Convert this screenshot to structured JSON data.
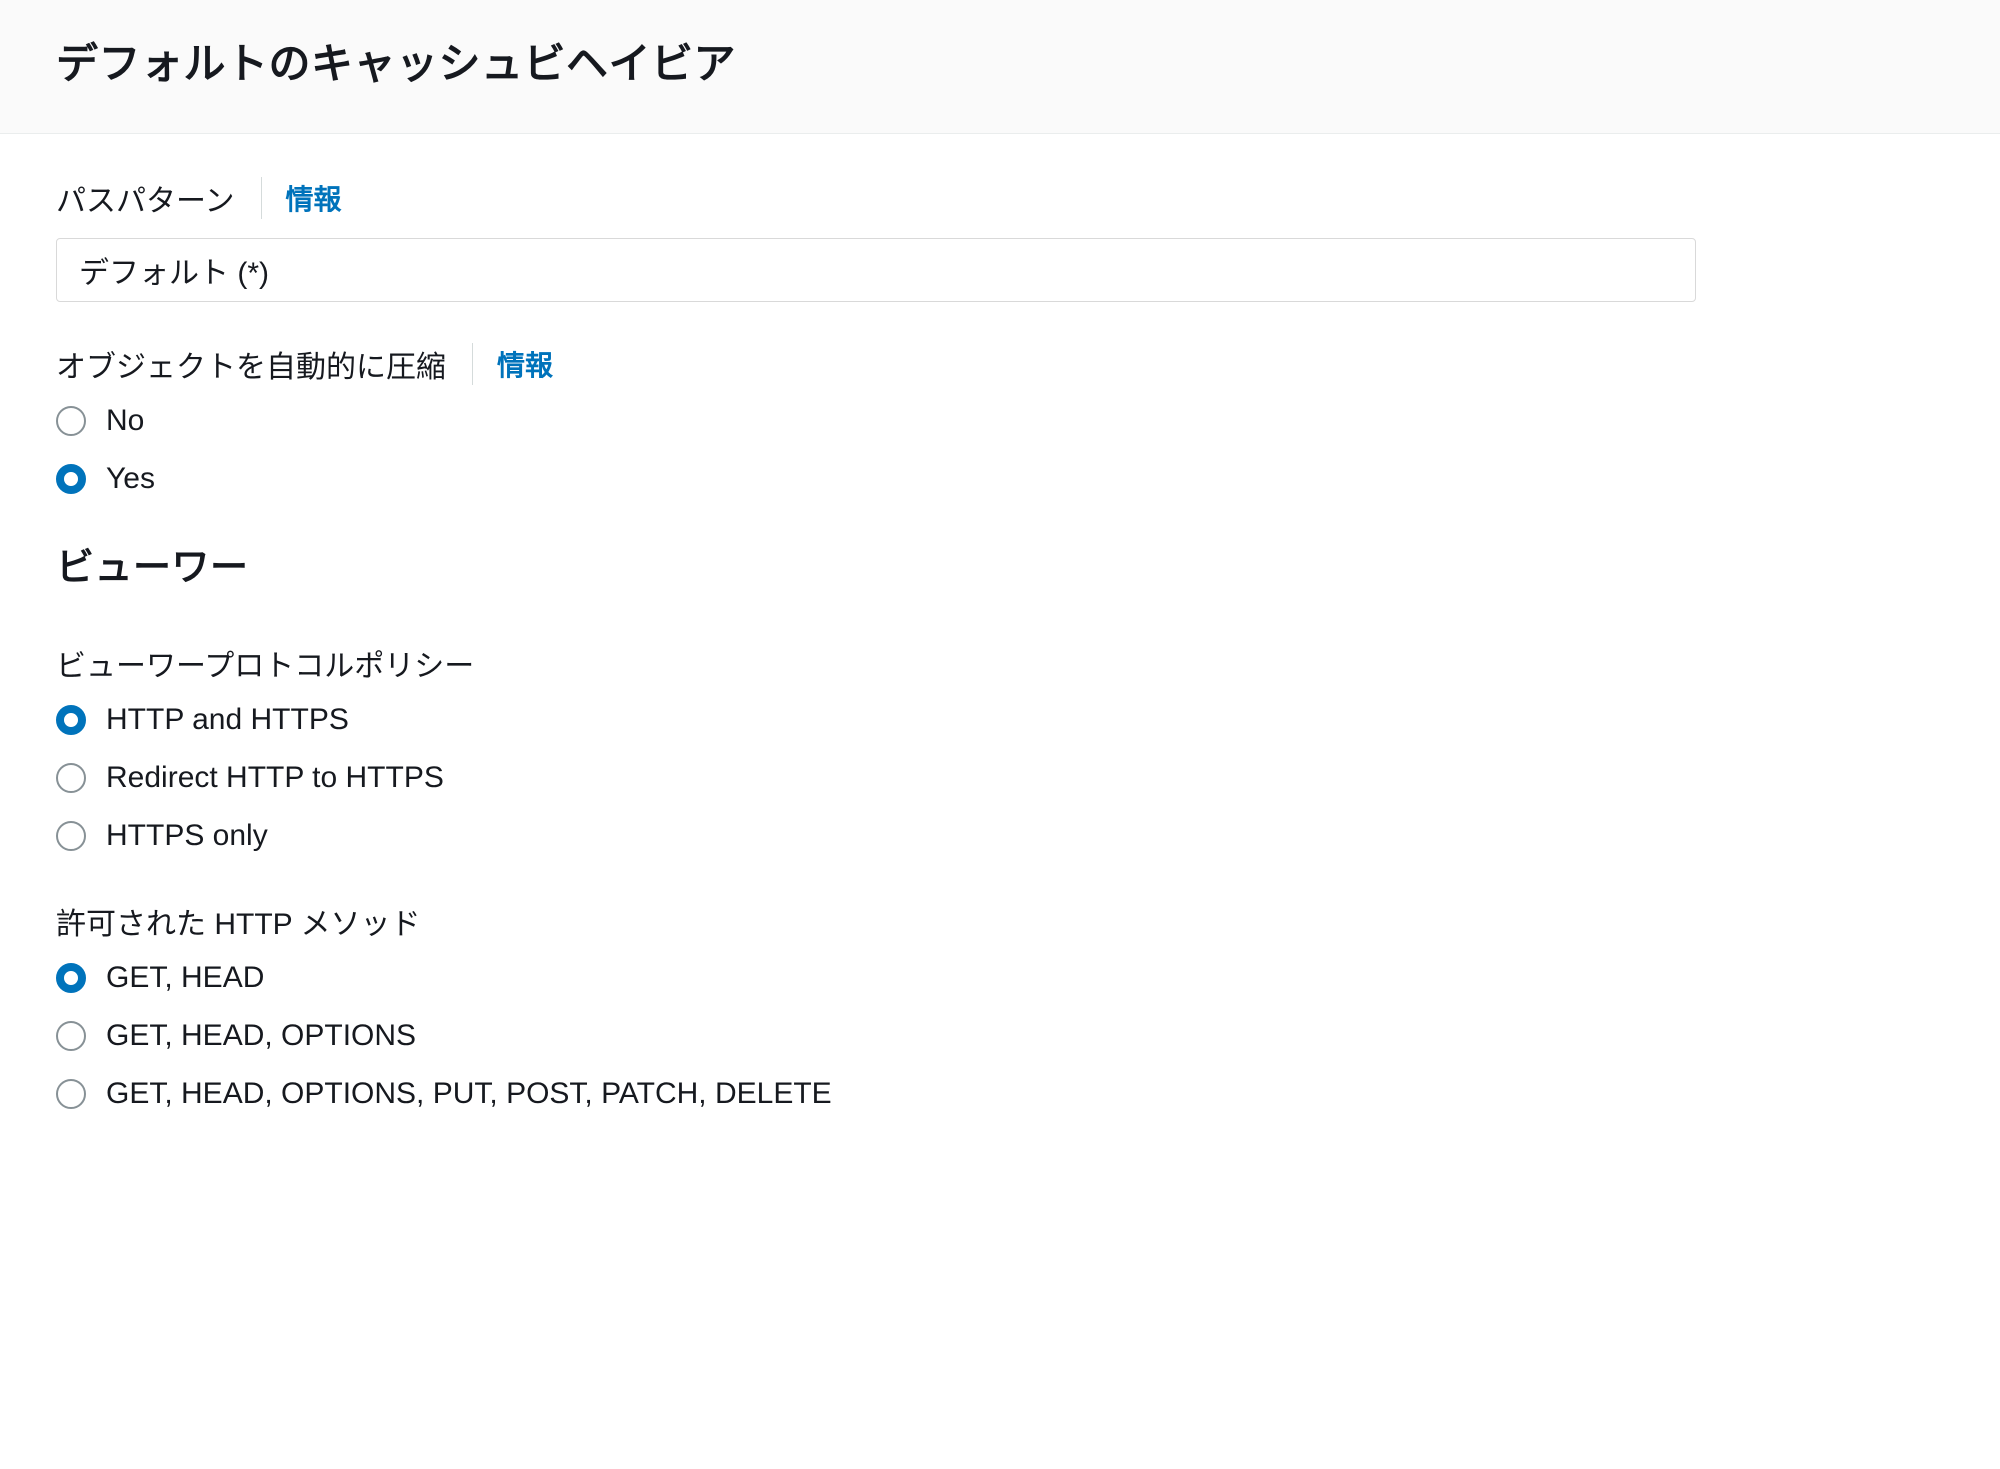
{
  "header": {
    "title": "デフォルトのキャッシュビヘイビア"
  },
  "pathPattern": {
    "label": "パスパターン",
    "infoLabel": "情報",
    "value": "デフォルト (*)"
  },
  "compress": {
    "label": "オブジェクトを自動的に圧縮",
    "infoLabel": "情報",
    "options": {
      "no": "No",
      "yes": "Yes"
    },
    "selected": "yes"
  },
  "viewer": {
    "heading": "ビューワー",
    "protocolPolicy": {
      "label": "ビューワープロトコルポリシー",
      "options": {
        "httpAndHttps": "HTTP and HTTPS",
        "redirect": "Redirect HTTP to HTTPS",
        "httpsOnly": "HTTPS only"
      },
      "selected": "httpAndHttps"
    },
    "allowedMethods": {
      "label": "許可された HTTP メソッド",
      "options": {
        "getHead": "GET, HEAD",
        "getHeadOptions": "GET, HEAD, OPTIONS",
        "all": "GET, HEAD, OPTIONS, PUT, POST, PATCH, DELETE"
      },
      "selected": "getHead"
    }
  }
}
